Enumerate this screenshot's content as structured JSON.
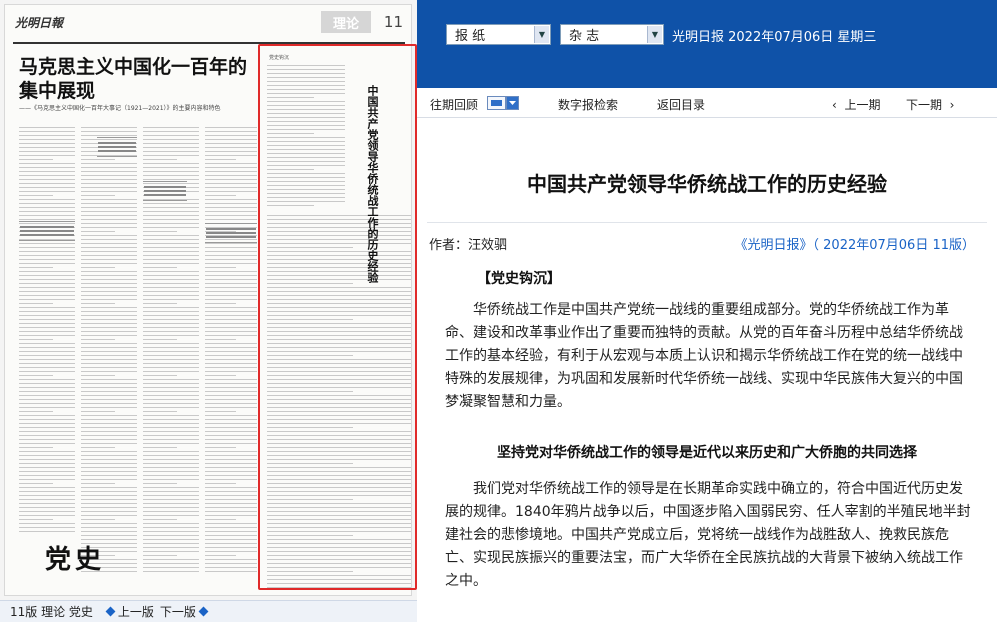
{
  "newspaper": {
    "masthead": "光明日報",
    "section": "理论",
    "page_number": "11",
    "lead_title": "马克思主义中国化一百年的集中展现",
    "lead_subtitle": "——《马克思主义中国化一百年大事记（1921—2021）》的主要内容和特色",
    "dangshi_logo": "党史",
    "highlight_title": "中国共产党领导华侨统战工作的历史经验",
    "highlight_badge": "党史钩沉"
  },
  "left_footer": {
    "section_label": "11版 理论 党史",
    "prev_page": "上一版",
    "next_page": "下一版"
  },
  "toolbar": {
    "type_select": "报    纸",
    "magazine_select": "杂    志",
    "paper_date": "光明日报  2022年07月06日  星期三"
  },
  "nav": {
    "archive": "往期回顾",
    "search": "数字报检索",
    "back": "返回目录",
    "prev_issue": "上一期",
    "next_issue": "下一期"
  },
  "article": {
    "title": "中国共产党领导华侨统战工作的历史经验",
    "author": "作者：汪效驷",
    "source": "《光明日报》（ 2022年07月06日   11版）",
    "kicker": "【党史钩沉】",
    "para1": "华侨统战工作是中国共产党统一战线的重要组成部分。党的华侨统战工作为革命、建设和改革事业作出了重要而独特的贡献。从党的百年奋斗历程中总结华侨统战工作的基本经验，有利于从宏观与本质上认识和揭示华侨统战工作在党的统一战线中特殊的发展规律，为巩固和发展新时代华侨统一战线、实现中华民族伟大复兴的中国梦凝聚智慧和力量。",
    "subheading": "坚持党对华侨统战工作的领导是近代以来历史和广大侨胞的共同选择",
    "para2": "我们党对华侨统战工作的领导是在长期革命实践中确立的，符合中国近代历史发展的规律。1840年鸦片战争以后，中国逐步陷入国弱民穷、任人宰割的半殖民地半封建社会的悲惨境地。中国共产党成立后，党将统一战线作为战胜敌人、挽救民族危亡、实现民族振兴的重要法宝，而广大华侨在全民族抗战的大背景下被纳入统战工作之中。"
  },
  "colors": {
    "top_bar": "#0f52a8",
    "highlight": "#e02a2a",
    "link": "#1a63c6"
  }
}
